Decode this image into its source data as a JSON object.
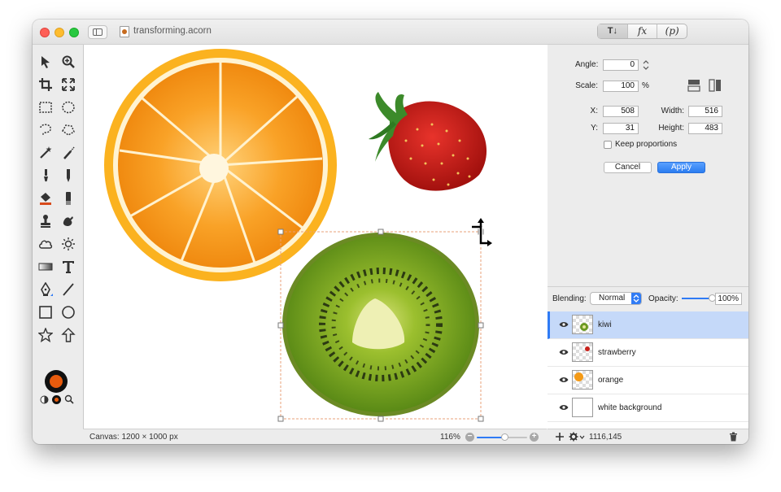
{
  "window": {
    "title": "transforming.acorn",
    "mode_tabs": [
      "T↓",
      "fx",
      "(p)"
    ]
  },
  "toolbar": {
    "tools": [
      "select-tool",
      "zoom-tool",
      "crop-tool",
      "transform-tool",
      "rect-select-tool",
      "ellipse-select-tool",
      "lasso-tool",
      "polygon-lasso-tool",
      "magic-wand-tool",
      "smart-select-tool",
      "brush-tool",
      "pencil-tool",
      "fill-tool",
      "eraser-tool",
      "clone-tool",
      "smudge-tool",
      "shape-cloud-tool",
      "sun-tool",
      "gradient-tool",
      "text-tool",
      "pen-tool",
      "line-tool",
      "rectangle-tool",
      "oval-tool",
      "star-tool",
      "arrow-tool"
    ],
    "fill_color": "#e85b0d",
    "stroke_color": "#111111"
  },
  "transform": {
    "angle_label": "Angle:",
    "angle": "0",
    "scale_label": "Scale:",
    "scale": "100",
    "scale_unit": "%",
    "x_label": "X:",
    "x": "508",
    "y_label": "Y:",
    "y": "31",
    "width_label": "Width:",
    "width": "516",
    "height_label": "Height:",
    "height": "483",
    "keep_proportions": "Keep proportions",
    "keep_proportions_checked": false,
    "cancel": "Cancel",
    "apply": "Apply"
  },
  "layers": {
    "blending_label": "Blending:",
    "blending_mode": "Normal",
    "opacity_label": "Opacity:",
    "opacity": "100%",
    "opacity_fraction": 1.0,
    "items": [
      {
        "name": "kiwi",
        "selected": true
      },
      {
        "name": "strawberry",
        "selected": false
      },
      {
        "name": "orange",
        "selected": false
      },
      {
        "name": "white background",
        "selected": false
      }
    ]
  },
  "status": {
    "canvas_size": "Canvas: 1200 × 1000 px",
    "zoom": "116%",
    "zoom_fraction": 0.55,
    "coords": "1116,145"
  },
  "colors": {
    "accent": "#2f7bf5",
    "selection_row": "#c5d9f9",
    "selection_outline": "#e8a07a"
  }
}
